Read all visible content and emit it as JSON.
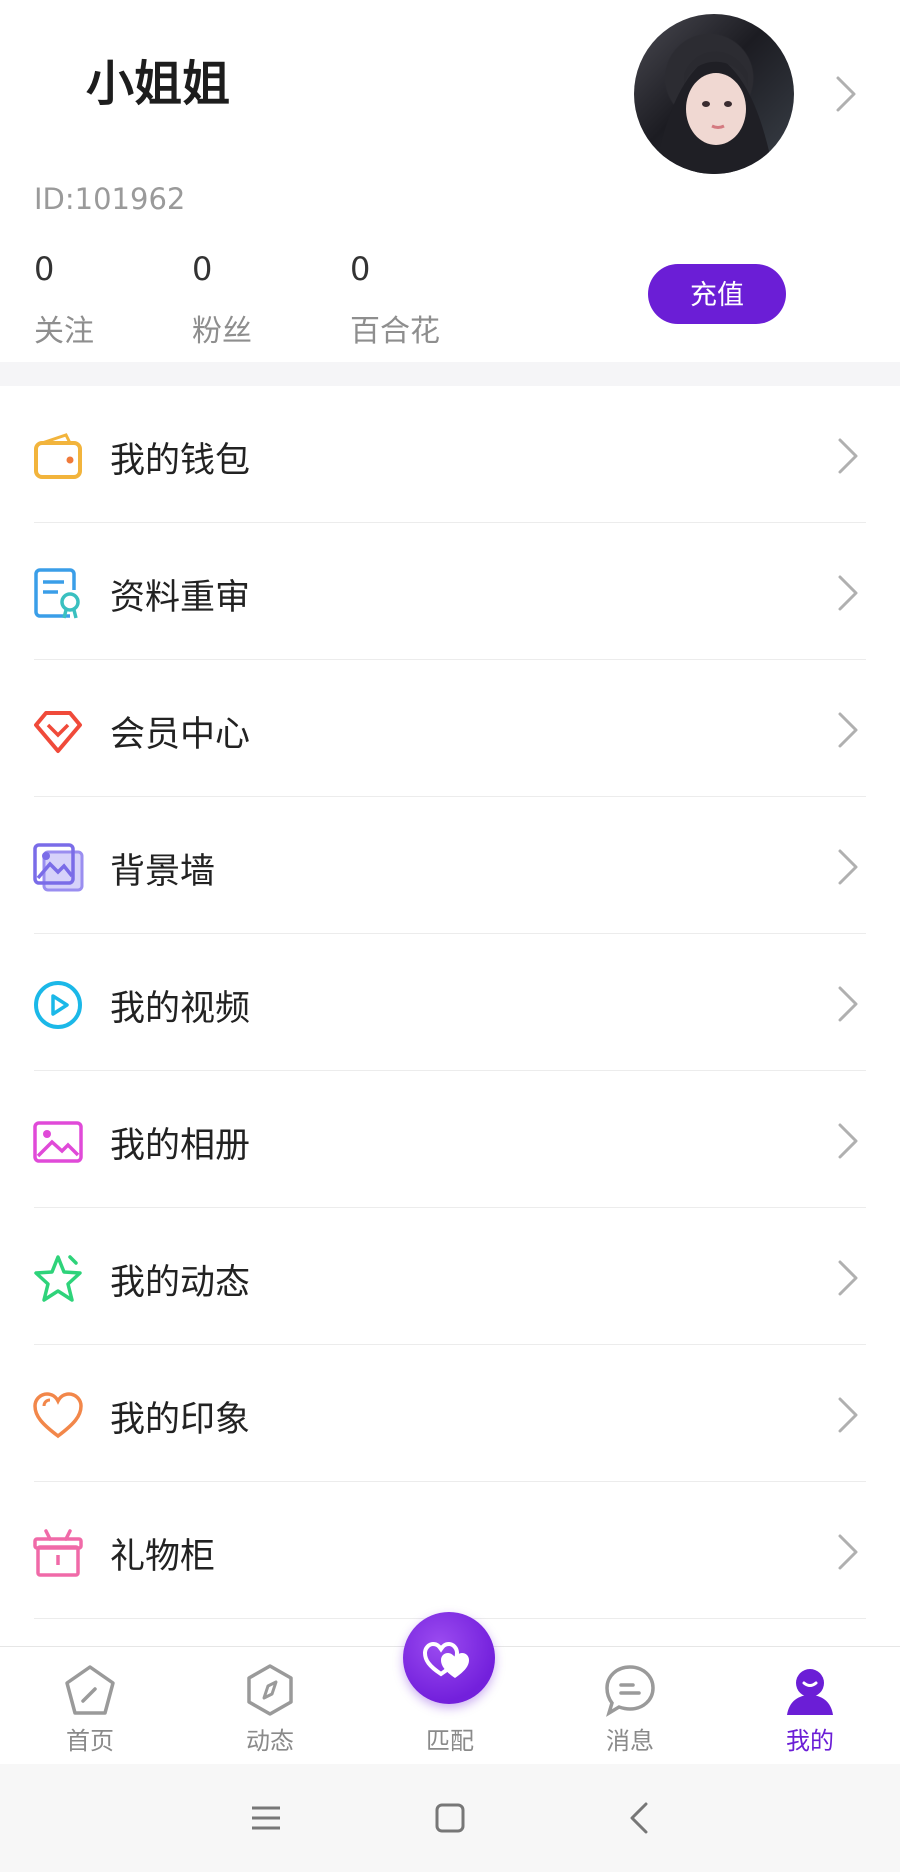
{
  "profile": {
    "name": "小姐姐",
    "id_text": "ID:101962",
    "stats": [
      {
        "value": "0",
        "label": "关注"
      },
      {
        "value": "0",
        "label": "粉丝"
      },
      {
        "value": "0",
        "label": "百合花"
      }
    ],
    "recharge_label": "充值"
  },
  "menu": [
    {
      "label": "我的钱包",
      "icon": "wallet-icon",
      "color": "#f2b43c"
    },
    {
      "label": "资料重审",
      "icon": "review-icon",
      "color": "#3a9ee8"
    },
    {
      "label": "会员中心",
      "icon": "diamond-icon",
      "color": "#f04a3a"
    },
    {
      "label": "背景墙",
      "icon": "gallery-icon",
      "color": "#7a6ce8"
    },
    {
      "label": "我的视频",
      "icon": "video-icon",
      "color": "#1bb8e8"
    },
    {
      "label": "我的相册",
      "icon": "album-icon",
      "color": "#e04ad8"
    },
    {
      "label": "我的动态",
      "icon": "star-icon",
      "color": "#2ed37a"
    },
    {
      "label": "我的印象",
      "icon": "heart-icon",
      "color": "#f2874a"
    },
    {
      "label": "礼物柜",
      "icon": "gift-icon",
      "color": "#f06aa8"
    }
  ],
  "tabs": [
    {
      "label": "首页",
      "icon": "home-icon",
      "active": false
    },
    {
      "label": "动态",
      "icon": "compass-icon",
      "active": false
    },
    {
      "label": "匹配",
      "icon": "match-icon",
      "active": false
    },
    {
      "label": "消息",
      "icon": "message-icon",
      "active": false
    },
    {
      "label": "我的",
      "icon": "profile-icon",
      "active": true
    }
  ],
  "colors": {
    "accent": "#6b1ed6",
    "chevron": "#b0b0b0"
  }
}
